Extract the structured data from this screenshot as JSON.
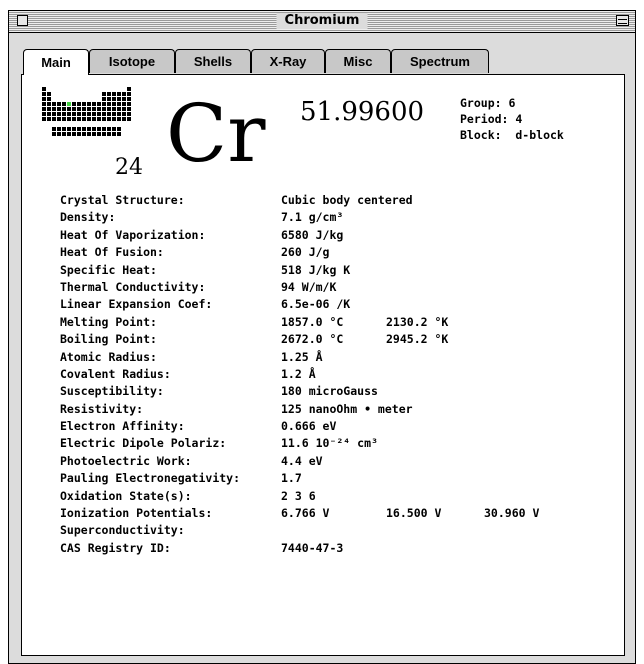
{
  "window": {
    "title": "Chromium"
  },
  "tabs": [
    {
      "label": "Main",
      "active": true
    },
    {
      "label": "Isotope",
      "active": false
    },
    {
      "label": "Shells",
      "active": false
    },
    {
      "label": "X-Ray",
      "active": false
    },
    {
      "label": "Misc",
      "active": false
    },
    {
      "label": "Spectrum",
      "active": false
    }
  ],
  "element": {
    "atomic_number": "24",
    "symbol": "Cr",
    "atomic_weight": "51.99600",
    "group": "Group: 6",
    "period": "Period: 4",
    "block": "Block:  d-block"
  },
  "colors": {
    "highlight": "#3fd23f"
  },
  "properties": [
    {
      "label": "Crystal Structure:",
      "value": "Cubic body centered"
    },
    {
      "label": "Density:",
      "value": "7.1 g/cm³"
    },
    {
      "label": "Heat Of Vaporization:",
      "value": "6580 J/kg"
    },
    {
      "label": "Heat Of Fusion:",
      "value": "260 J/g"
    },
    {
      "label": "Specific Heat:",
      "value": "518 J/kg K"
    },
    {
      "label": "Thermal Conductivity:",
      "value": "94 W/m/K"
    },
    {
      "label": "Linear Expansion Coef:",
      "value": "6.5e-06 /K"
    },
    {
      "label": "Melting Point:",
      "value": "1857.0 °C",
      "value2": "2130.2 °K"
    },
    {
      "label": "Boiling Point:",
      "value": "2672.0 °C",
      "value2": "2945.2 °K"
    },
    {
      "label": "Atomic Radius:",
      "value": "1.25 Å"
    },
    {
      "label": "Covalent Radius:",
      "value": "1.2 Å"
    },
    {
      "label": "Susceptibility:",
      "value": "180 microGauss"
    },
    {
      "label": "Resistivity:",
      "value": "125 nanoOhm • meter"
    },
    {
      "label": "Electron Affinity:",
      "value": "0.666 eV"
    },
    {
      "label": "Electric Dipole Polariz:",
      "value": "11.6 10⁻²⁴ cm³"
    },
    {
      "label": "Photoelectric Work:",
      "value": "4.4 eV"
    },
    {
      "label": "Pauling Electronegativity:",
      "value": "1.7"
    },
    {
      "label": "Oxidation State(s):",
      "value": "2  3  6"
    },
    {
      "label": "Ionization Potentials:",
      "value": "6.766 V",
      "value2": "16.500 V",
      "value3": "30.960 V"
    },
    {
      "label": "Superconductivity:",
      "value": ""
    },
    {
      "label": "CAS Registry ID:",
      "value": "7440-47-3"
    }
  ]
}
